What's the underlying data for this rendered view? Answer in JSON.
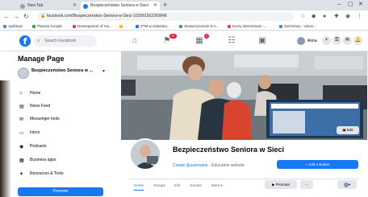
{
  "browser": {
    "tabs": [
      {
        "title": "New Tab",
        "active": false
      },
      {
        "title": "Bezpieczeństwo Seniora w Sieci",
        "active": true
      }
    ],
    "new_tab_symbol": "+",
    "url": "facebook.com/Bezpieczenstwo-Seniora-w-Sieci-103991562260848",
    "bookmarks": [
      {
        "label": "Aplikacje",
        "color": "#4285f4"
      },
      {
        "label": "Planeta Google",
        "color": "#34a853"
      },
      {
        "label": "Development of ma...",
        "color": "#ea4335"
      },
      {
        "label": "...",
        "color": "#fbbc05"
      },
      {
        "label": "ZTM w Gdansku...",
        "color": "#1877f2"
      },
      {
        "label": "Stowarzyszenie E-s...",
        "color": "#34a853"
      },
      {
        "label": "Kursy internetowe -...",
        "color": "#ea4335"
      },
      {
        "label": "Jarzmiany - Unive...",
        "color": "#4285f4"
      }
    ]
  },
  "facebook": {
    "logo": "f",
    "search_placeholder": "Search Facebook",
    "nav_icons": [
      {
        "icon": "home-icon",
        "glyph": "⌂",
        "badge": ""
      },
      {
        "icon": "flag-icon",
        "glyph": "⚑",
        "badge": "9+"
      },
      {
        "icon": "store-icon",
        "glyph": "▦",
        "badge": "1"
      },
      {
        "icon": "groups-icon",
        "glyph": "☷",
        "badge": ""
      },
      {
        "icon": "gaming-icon",
        "glyph": "▣",
        "badge": ""
      }
    ],
    "profile_name": "Anna",
    "right_icons": [
      "+",
      "☰",
      "✉",
      "🔔",
      "▾"
    ]
  },
  "sidebar": {
    "heading": "Manage Page",
    "page_name": "Bezpieczeństwo Seniora w ...",
    "items": [
      {
        "label": "Home",
        "icon": "home-icon",
        "glyph": "⌂"
      },
      {
        "label": "News Feed",
        "icon": "news-feed-icon",
        "glyph": "▤"
      },
      {
        "label": "Messenger tools",
        "icon": "messenger-icon",
        "glyph": "✉"
      },
      {
        "label": "Inbox",
        "icon": "inbox-icon",
        "glyph": "▭"
      },
      {
        "label": "Podcasts",
        "icon": "podcasts-icon",
        "glyph": "◉"
      },
      {
        "label": "Business apps",
        "icon": "business-apps-icon",
        "glyph": "▦"
      },
      {
        "label": "Resources & Tools",
        "icon": "resources-icon",
        "glyph": "✦"
      }
    ],
    "promote_label": "Promote"
  },
  "page": {
    "title": "Bezpieczeństwo Seniora w Sieci",
    "username": "Create @username",
    "category": "· Education website",
    "add_button": "+ Add a Button",
    "edit_cover": "Edit",
    "tabs": [
      "Home",
      "Groups",
      "Info",
      "Events",
      "More ▾"
    ],
    "actions": {
      "promote": "Promote",
      "more": "···",
      "view_as": "▾"
    }
  }
}
